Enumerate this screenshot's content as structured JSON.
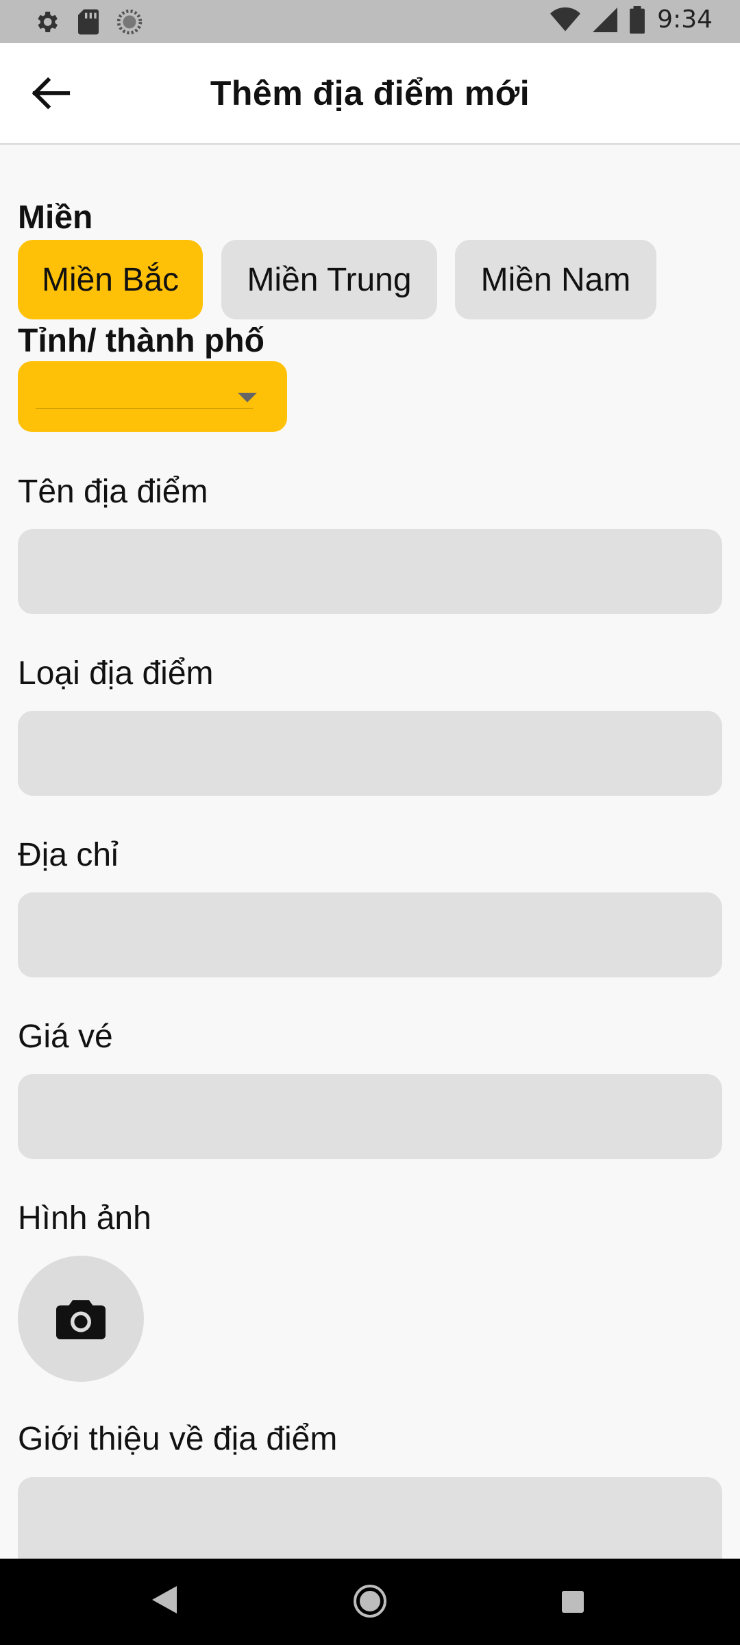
{
  "status_bar": {
    "time": "9:34",
    "icons": [
      "settings-icon",
      "sd-card-icon",
      "sync-icon",
      "wifi-icon",
      "signal-icon",
      "battery-icon"
    ]
  },
  "app_bar": {
    "title": "Thêm địa điểm mới",
    "back_icon": "arrow-left-icon"
  },
  "region": {
    "label": "Miền",
    "options": [
      "Miền Bắc",
      "Miền Trung",
      "Miền Nam"
    ],
    "selected": "Miền Bắc"
  },
  "province": {
    "label": "Tỉnh/ thành phố",
    "value": ""
  },
  "fields": [
    {
      "label": "Tên địa điểm",
      "value": ""
    },
    {
      "label": "Loại địa điểm",
      "value": ""
    },
    {
      "label": "Địa chỉ",
      "value": ""
    },
    {
      "label": "Giá vé",
      "value": ""
    }
  ],
  "image": {
    "label": "Hình ảnh",
    "icon": "camera-icon"
  },
  "intro": {
    "label": "Giới thiệu về địa điểm",
    "value": ""
  },
  "colors": {
    "accent": "#ffc107",
    "field_bg": "#e0e0e0",
    "page_bg": "#f8f8f8"
  }
}
